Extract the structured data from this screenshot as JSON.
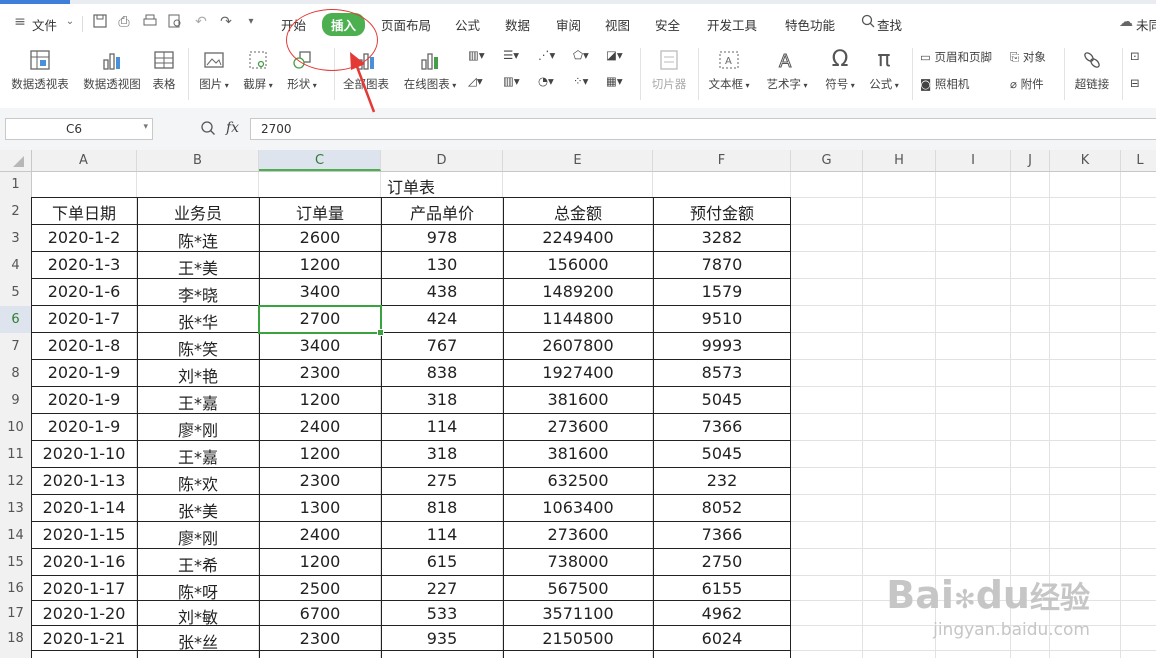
{
  "menubar": {
    "file_label": "文件",
    "tabs": [
      "开始",
      "插入",
      "页面布局",
      "公式",
      "数据",
      "审阅",
      "视图",
      "安全",
      "开发工具",
      "特色功能"
    ],
    "search_label": "查找",
    "right_label": "未同"
  },
  "ribbon": {
    "pivot_table": "数据透视表",
    "pivot_chart": "数据透视图",
    "table": "表格",
    "picture": "图片",
    "screenshot": "截屏",
    "shape": "形状",
    "all_charts": "全部图表",
    "online_chart": "在线图表",
    "slicer": "切片器",
    "textbox": "文本框",
    "wordart": "艺术字",
    "symbol": "符号",
    "formula": "公式",
    "header_footer": "页眉和页脚",
    "object": "对象",
    "camera": "照相机",
    "attachment": "附件",
    "hyperlink": "超链接"
  },
  "formula_bar": {
    "name_box": "C6",
    "fx_label": "fx",
    "value": "2700"
  },
  "sheet": {
    "columns": [
      "A",
      "B",
      "C",
      "D",
      "E",
      "F",
      "G",
      "H",
      "I",
      "J",
      "K",
      "L"
    ],
    "row_numbers": [
      "1",
      "2",
      "3",
      "4",
      "5",
      "6",
      "7",
      "8",
      "9",
      "10",
      "11",
      "12",
      "13",
      "14",
      "15",
      "16",
      "17",
      "18"
    ],
    "title": "订单表",
    "headers": [
      "下单日期",
      "业务员",
      "订单量",
      "产品单价",
      "总金额",
      "预付金额"
    ],
    "rows": [
      [
        "2020-1-2",
        "陈*连",
        "2600",
        "978",
        "2249400",
        "3282"
      ],
      [
        "2020-1-3",
        "王*美",
        "1200",
        "130",
        "156000",
        "7870"
      ],
      [
        "2020-1-6",
        "李*晓",
        "3400",
        "438",
        "1489200",
        "1579"
      ],
      [
        "2020-1-7",
        "张*华",
        "2700",
        "424",
        "1144800",
        "9510"
      ],
      [
        "2020-1-8",
        "陈*笑",
        "3400",
        "767",
        "2607800",
        "9993"
      ],
      [
        "2020-1-9",
        "刘*艳",
        "2300",
        "838",
        "1927400",
        "8573"
      ],
      [
        "2020-1-9",
        "王*嘉",
        "1200",
        "318",
        "381600",
        "5045"
      ],
      [
        "2020-1-9",
        "廖*刚",
        "2400",
        "114",
        "273600",
        "7366"
      ],
      [
        "2020-1-10",
        "王*嘉",
        "1200",
        "318",
        "381600",
        "5045"
      ],
      [
        "2020-1-13",
        "陈*欢",
        "2300",
        "275",
        "632500",
        "232"
      ],
      [
        "2020-1-14",
        "张*美",
        "1300",
        "818",
        "1063400",
        "8052"
      ],
      [
        "2020-1-15",
        "廖*刚",
        "2400",
        "114",
        "273600",
        "7366"
      ],
      [
        "2020-1-16",
        "王*希",
        "1200",
        "615",
        "738000",
        "2750"
      ],
      [
        "2020-1-17",
        "陈*呀",
        "2500",
        "227",
        "567500",
        "6155"
      ],
      [
        "2020-1-20",
        "刘*敏",
        "6700",
        "533",
        "3571100",
        "4962"
      ],
      [
        "2020-1-21",
        "张*丝",
        "2300",
        "935",
        "2150500",
        "6024"
      ]
    ],
    "selected_cell": "C6"
  },
  "watermark": {
    "brand": "Bai",
    "brand2": "du",
    "brand_cn": "经验",
    "url": "jingyan.baidu.com"
  },
  "colors": {
    "accent_green": "#4caf50",
    "annotation_red": "#e53935"
  }
}
